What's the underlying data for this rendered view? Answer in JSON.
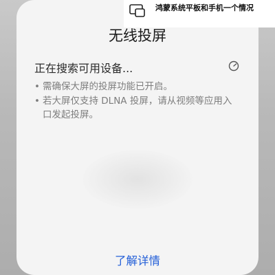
{
  "dialog": {
    "title": "无线投屏",
    "status": "正在搜索可用设备...",
    "hints": [
      "需确保大屏的投屏功能已开启。",
      "若大屏仅支持 DLNA 投屏，请从视频等应用入口发起投屏。"
    ],
    "bullet": "•",
    "learn_more": "了解详情"
  },
  "overlay": {
    "text": "鸿蒙系统平板和手机一个情况",
    "icon": "screen-cast-icon"
  },
  "icons": {
    "spinner": "loading-spinner-icon"
  },
  "colors": {
    "accent": "#2560d8",
    "dialog_bg": "#f4f4f4",
    "hint_text": "#7d7d7d"
  }
}
